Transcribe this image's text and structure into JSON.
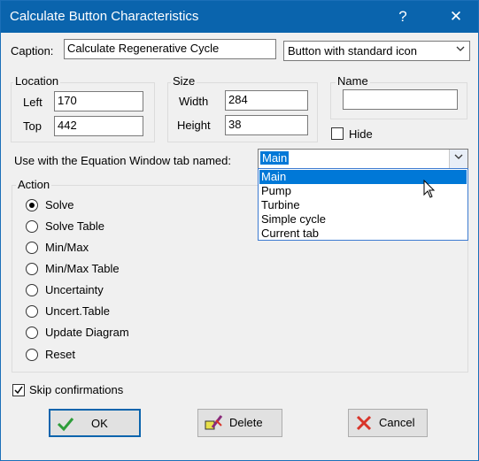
{
  "window": {
    "title": "Calculate Button Characteristics",
    "help_glyph": "?",
    "close_glyph": "✕"
  },
  "caption": {
    "label": "Caption:",
    "value": "Calculate Regenerative Cycle"
  },
  "icon_style": {
    "value": "Button with standard icon"
  },
  "location": {
    "title": "Location",
    "left_label": "Left",
    "left_value": "170",
    "top_label": "Top",
    "top_value": "442"
  },
  "size": {
    "title": "Size",
    "width_label": "Width",
    "width_value": "284",
    "height_label": "Height",
    "height_value": "38"
  },
  "name": {
    "title": "Name",
    "value": ""
  },
  "hide": {
    "label": "Hide",
    "checked": false
  },
  "tab": {
    "label": "Use with the Equation Window tab named:",
    "value": "Main",
    "options": [
      "Main",
      "Pump",
      "Turbine",
      "Simple cycle",
      "Current tab"
    ]
  },
  "action": {
    "title": "Action",
    "options": [
      "Solve",
      "Solve Table",
      "Min/Max",
      "Min/Max Table",
      "Uncertainty",
      "Uncert.Table",
      "Update Diagram",
      "Reset"
    ],
    "selected": "Solve"
  },
  "skip": {
    "label": "Skip confirmations",
    "checked": true
  },
  "buttons": {
    "ok": "OK",
    "delete": "Delete",
    "cancel": "Cancel"
  },
  "colors": {
    "titlebar": "#0a64ad",
    "selection": "#0078d7",
    "ok_check": "#2e9d3a",
    "cancel_x": "#d8352a"
  }
}
